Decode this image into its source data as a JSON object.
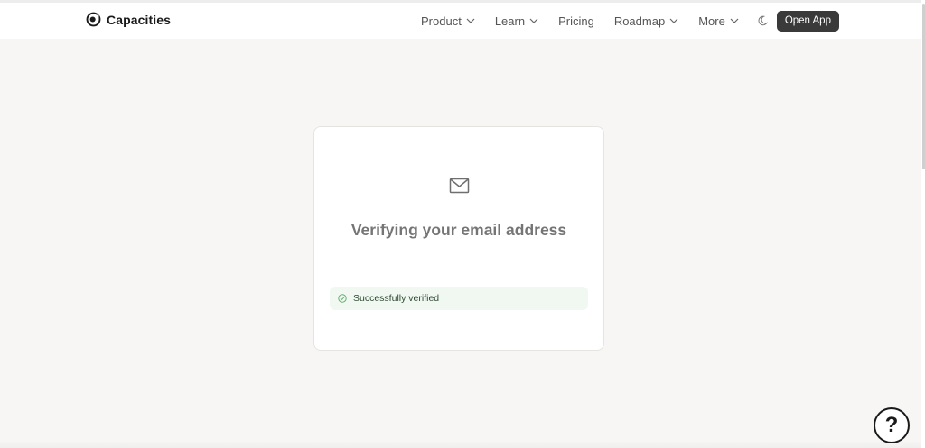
{
  "brand": {
    "name": "Capacities",
    "logo_icon": "capacities-logo-icon"
  },
  "nav": {
    "items": [
      {
        "label": "Product",
        "has_dropdown": true
      },
      {
        "label": "Learn",
        "has_dropdown": true
      },
      {
        "label": "Pricing",
        "has_dropdown": false
      },
      {
        "label": "Roadmap",
        "has_dropdown": true
      },
      {
        "label": "More",
        "has_dropdown": true
      }
    ],
    "theme_toggle_icon": "moon-icon",
    "cta_label": "Open App"
  },
  "card": {
    "icon": "mail-icon",
    "title": "Verifying your email address",
    "status": {
      "icon": "check-circle-icon",
      "text": "Successfully verified",
      "color": "#63b06e"
    }
  },
  "help": {
    "label": "?",
    "icon": "help-icon"
  },
  "colors": {
    "background": "#f7f6f4",
    "cta_background": "#3a3a3a",
    "success_background": "#f0f8f1"
  }
}
